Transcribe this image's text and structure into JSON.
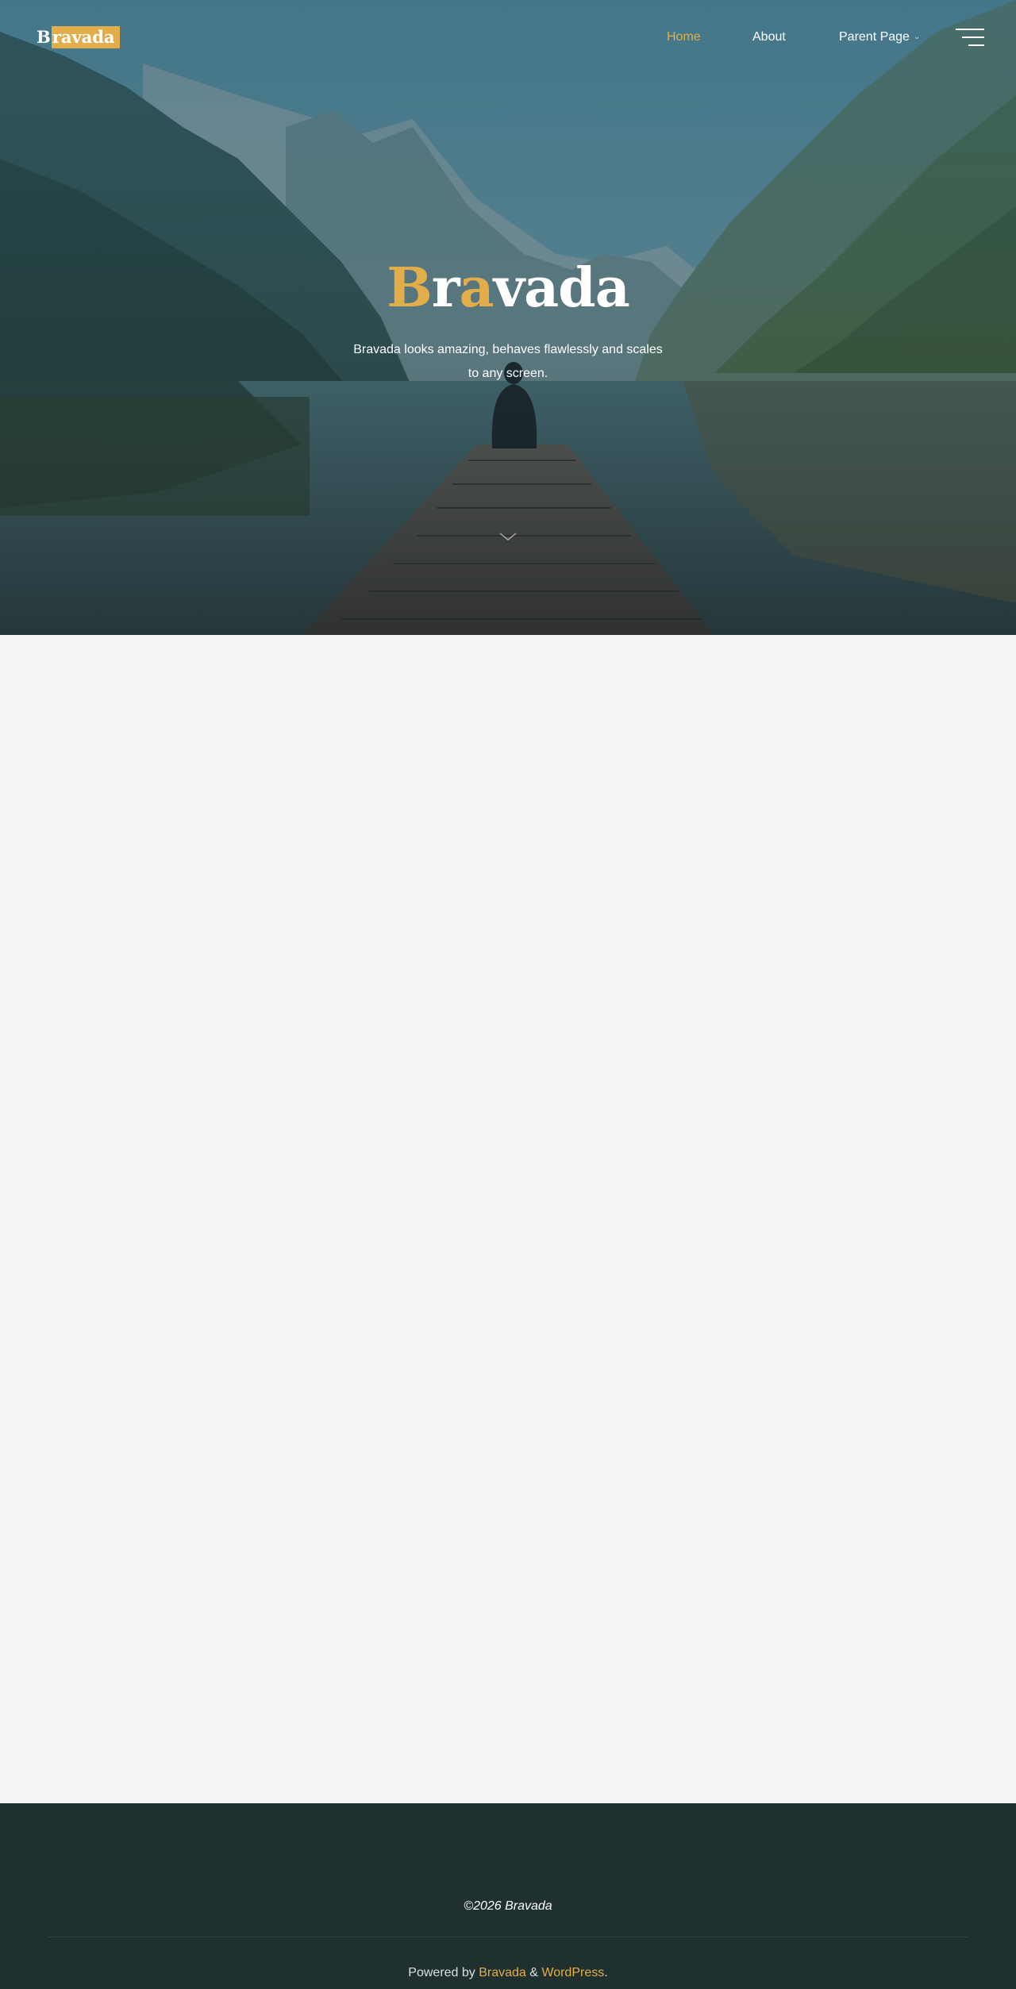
{
  "site": {
    "logo_first": "B",
    "logo_rest": "ravada"
  },
  "nav": {
    "items": [
      {
        "label": "Home",
        "active": true
      },
      {
        "label": "About",
        "active": false
      },
      {
        "label": "Parent Page",
        "active": false
      }
    ],
    "menu_icon": "hamburger-icon",
    "dropdown_icon": "chevron-down-icon"
  },
  "hero": {
    "title_parts": [
      "B",
      "r",
      "a",
      "vada"
    ],
    "subtitle": "Bravada looks amazing, behaves flawlessly and scales to any screen.",
    "scroll_icon": "chevron-down-icon"
  },
  "footer": {
    "copyright": "©2026 Bravada",
    "powered_prefix": "Powered by ",
    "powered_link1": "Bravada",
    "powered_amp": " & ",
    "powered_link2": "WordPress",
    "powered_suffix": "."
  },
  "colors": {
    "accent": "#e2ae4c",
    "footer_bg": "#1f302f",
    "body_bg": "#f3f6f5"
  }
}
